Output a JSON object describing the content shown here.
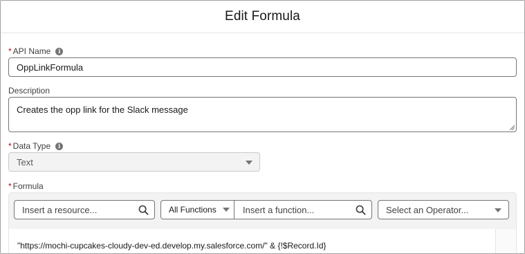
{
  "header": {
    "title": "Edit Formula"
  },
  "api_name": {
    "label": "API Name",
    "value": "OppLinkFormula",
    "info_icon": "info-icon"
  },
  "description": {
    "label": "Description",
    "value": "Creates the opp link for the Slack message"
  },
  "data_type": {
    "label": "Data Type",
    "value": "Text",
    "disabled": true
  },
  "formula": {
    "label": "Formula",
    "resource_placeholder": "Insert a resource...",
    "functions_filter": "All Functions",
    "function_placeholder": "Insert a function...",
    "operator_placeholder": "Select an Operator...",
    "expression": "\"https://mochi-cupcakes-cloudy-dev-ed.develop.my.salesforce.com/\" & {!$Record.Id}"
  },
  "colors": {
    "required": "#ba0517",
    "border": "#747474",
    "toolbar_bg": "#f3f3f3"
  }
}
